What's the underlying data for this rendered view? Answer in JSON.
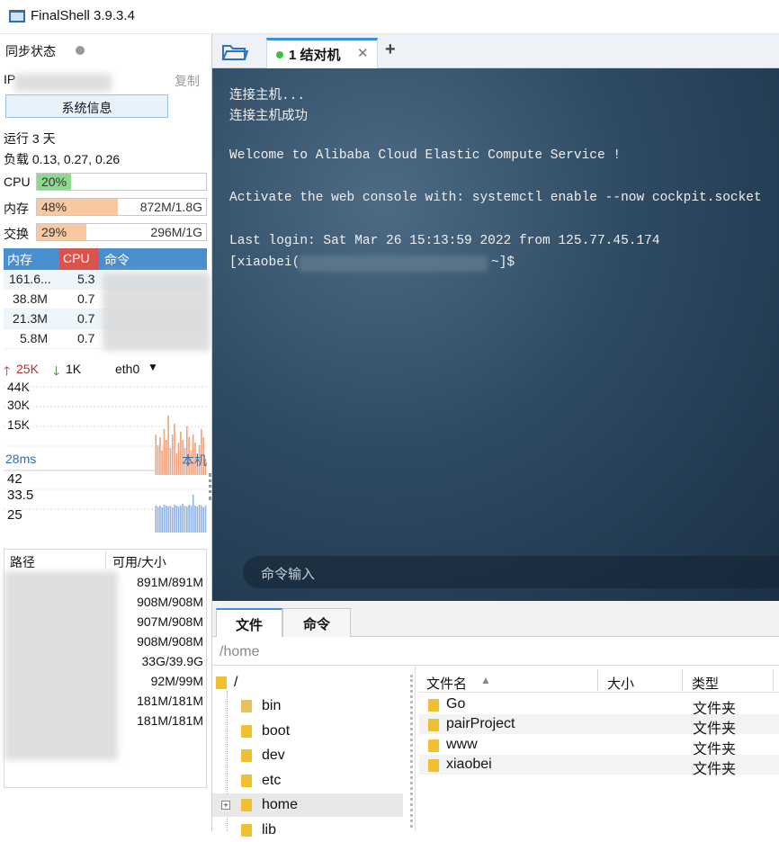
{
  "window": {
    "title": "FinalShell 3.9.3.4"
  },
  "sidebar": {
    "sync_label": "同步状态",
    "ip_label": "IP",
    "copy_label": "复制",
    "sysinfo_button": "系统信息",
    "uptime": "运行 3 天",
    "load": "负载 0.13, 0.27, 0.26",
    "bars": [
      {
        "label": "CPU",
        "pct": "20%",
        "value": "",
        "fill": 0.2,
        "color": "#8fd88f"
      },
      {
        "label": "内存",
        "pct": "48%",
        "value": "872M/1.8G",
        "fill": 0.48,
        "color": "#f8c8a0"
      },
      {
        "label": "交换",
        "pct": "29%",
        "value": "296M/1G",
        "fill": 0.29,
        "color": "#f8c8a0"
      }
    ],
    "process_table": {
      "headers": [
        "内存",
        "CPU",
        "命令"
      ],
      "rows": [
        {
          "mem": "161.6...",
          "cpu": "5.3"
        },
        {
          "mem": "38.8M",
          "cpu": "0.7"
        },
        {
          "mem": "21.3M",
          "cpu": "0.7"
        },
        {
          "mem": "5.8M",
          "cpu": "0.7"
        }
      ]
    },
    "network": {
      "up": "25K",
      "down": "1K",
      "interface": "eth0",
      "ticks": [
        "44K",
        "30K",
        "15K"
      ]
    },
    "latency": {
      "value": "28ms",
      "host": "本机",
      "ticks": [
        "42",
        "33.5",
        "25"
      ]
    },
    "disk_table": {
      "headers": [
        "路径",
        "可用/大小"
      ],
      "rows": [
        "891M/891M",
        "908M/908M",
        "907M/908M",
        "908M/908M",
        "33G/39.9G",
        "92M/99M",
        "181M/181M",
        "181M/181M"
      ]
    }
  },
  "tabs": [
    {
      "label": "1 结对机",
      "status_color": "#3cc13c"
    }
  ],
  "terminal": {
    "lines": [
      "连接主机...",
      "连接主机成功",
      "",
      "Welcome to Alibaba Cloud Elastic Compute Service !",
      "",
      "Activate the web console with: systemctl enable --now cockpit.socket",
      "",
      "Last login: Sat Mar 26 15:13:59 2022 from 125.77.45.174"
    ],
    "prompt_user": "[xiaobei(",
    "prompt_end": "~]$",
    "command_placeholder": "命令输入"
  },
  "bottom": {
    "tabs": [
      "文件",
      "命令"
    ],
    "path": "/home",
    "tree": [
      "/",
      "bin",
      "boot",
      "dev",
      "etc",
      "home",
      "lib"
    ],
    "file_headers": [
      "文件名",
      "大小",
      "类型"
    ],
    "files": [
      {
        "name": "Go",
        "type": "文件夹"
      },
      {
        "name": "pairProject",
        "type": "文件夹"
      },
      {
        "name": "www",
        "type": "文件夹"
      },
      {
        "name": "xiaobei",
        "type": "文件夹"
      }
    ]
  },
  "charts": {
    "network_bars": [
      0,
      0,
      0,
      0,
      0,
      0,
      0,
      0,
      0,
      0,
      0,
      0,
      0,
      0,
      0,
      0,
      0,
      0,
      0,
      0,
      0,
      0,
      0,
      0,
      0,
      0,
      0,
      0,
      0,
      0,
      0,
      0,
      0,
      0,
      0,
      0,
      0,
      0,
      0,
      0,
      0,
      0,
      0,
      0,
      0,
      0,
      0,
      0,
      0,
      0,
      0,
      0,
      0,
      0,
      0,
      0,
      0,
      0,
      0,
      0,
      0,
      0,
      0,
      0,
      0,
      0,
      0,
      0,
      0,
      0,
      0,
      0,
      0,
      0,
      0,
      0,
      0,
      0,
      0,
      0,
      0,
      0,
      0,
      0,
      0,
      0,
      0,
      0,
      0,
      0,
      0,
      0,
      0,
      0,
      0,
      0,
      0,
      0,
      0,
      0,
      0,
      0,
      0,
      0,
      0,
      0,
      0,
      0,
      0,
      0,
      0,
      0,
      0,
      0,
      0,
      0,
      0,
      0,
      0,
      0,
      0,
      0,
      0,
      0,
      0,
      0,
      0,
      0,
      0,
      0,
      0,
      0,
      0,
      0,
      0,
      0,
      0,
      0,
      0,
      0,
      0,
      0,
      0,
      0,
      0,
      0,
      0,
      0,
      0,
      0,
      0,
      0,
      0,
      0,
      0,
      0,
      0,
      0,
      0,
      0,
      0,
      0,
      0,
      0,
      0,
      30,
      22,
      28,
      18,
      34,
      26,
      44,
      20,
      30,
      38,
      16,
      24,
      32,
      26,
      20,
      36,
      28,
      18,
      30,
      24,
      16,
      22,
      34,
      28,
      12
    ],
    "latency_bars": [
      0,
      0,
      0,
      0,
      0,
      0,
      0,
      0,
      0,
      0,
      0,
      0,
      0,
      0,
      0,
      0,
      0,
      0,
      0,
      0,
      0,
      0,
      0,
      0,
      0,
      0,
      0,
      0,
      0,
      0,
      0,
      0,
      0,
      0,
      0,
      0,
      0,
      0,
      0,
      0,
      0,
      0,
      0,
      0,
      0,
      0,
      0,
      0,
      0,
      0,
      0,
      0,
      0,
      0,
      0,
      0,
      0,
      0,
      0,
      0,
      0,
      0,
      0,
      0,
      0,
      0,
      0,
      0,
      0,
      0,
      0,
      0,
      0,
      0,
      0,
      0,
      0,
      0,
      0,
      0,
      0,
      0,
      0,
      0,
      0,
      0,
      0,
      0,
      0,
      0,
      0,
      0,
      0,
      0,
      0,
      0,
      0,
      0,
      0,
      0,
      0,
      0,
      0,
      0,
      0,
      0,
      0,
      0,
      0,
      0,
      0,
      0,
      0,
      0,
      0,
      0,
      0,
      0,
      0,
      0,
      0,
      0,
      0,
      0,
      0,
      0,
      0,
      0,
      0,
      0,
      0,
      0,
      0,
      0,
      0,
      0,
      0,
      0,
      0,
      0,
      0,
      0,
      0,
      0,
      0,
      0,
      0,
      0,
      0,
      0,
      0,
      0,
      0,
      0,
      0,
      0,
      0,
      0,
      0,
      0,
      0,
      0,
      0,
      0,
      0,
      30,
      29,
      30,
      28,
      31,
      30,
      29,
      30,
      28,
      31,
      30,
      29,
      30,
      32,
      30,
      29,
      31,
      30,
      42,
      30,
      29,
      31,
      30,
      28,
      30
    ]
  }
}
